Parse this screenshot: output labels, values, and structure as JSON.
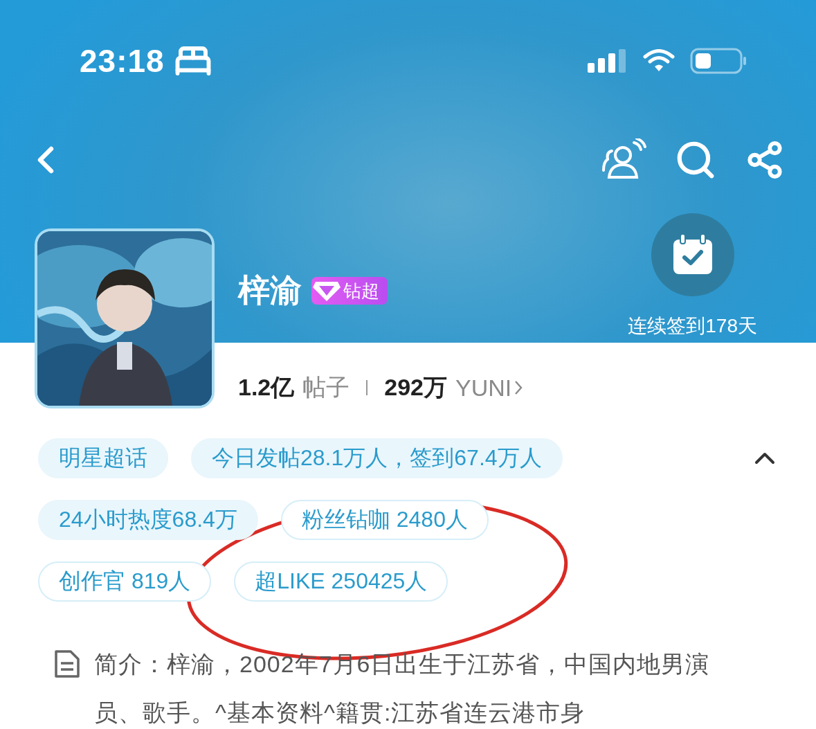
{
  "status_bar": {
    "time": "23:18"
  },
  "profile": {
    "name": "梓渝",
    "badge": "钻超",
    "stats": [
      {
        "count": "1.2亿",
        "unit": "帖子",
        "link": false
      },
      {
        "count": "292万",
        "unit": "YUNI",
        "link": true
      }
    ],
    "checkin": {
      "text": "连续签到178天",
      "checked": true
    }
  },
  "tags": {
    "expanded": true,
    "rows": [
      [
        {
          "text": "明星超话",
          "kind": "filled"
        },
        {
          "text": "今日发帖28.1万人，签到67.4万人",
          "kind": "filled"
        }
      ],
      [
        {
          "text": "24小时热度68.4万",
          "kind": "filled"
        },
        {
          "text": "粉丝钻咖 2480人",
          "kind": "outlined"
        }
      ],
      [
        {
          "text": "创作官 819人",
          "kind": "outlined"
        },
        {
          "text": "超LIKE 250425人",
          "kind": "outlined"
        }
      ]
    ]
  },
  "intro": {
    "text": "简介：梓渝，2002年7月6日出生于江苏省，中国内地男演员、歌手。^基本资料^籍贯:江苏省连云港市身"
  },
  "annotation": {
    "kind": "ellipse"
  }
}
